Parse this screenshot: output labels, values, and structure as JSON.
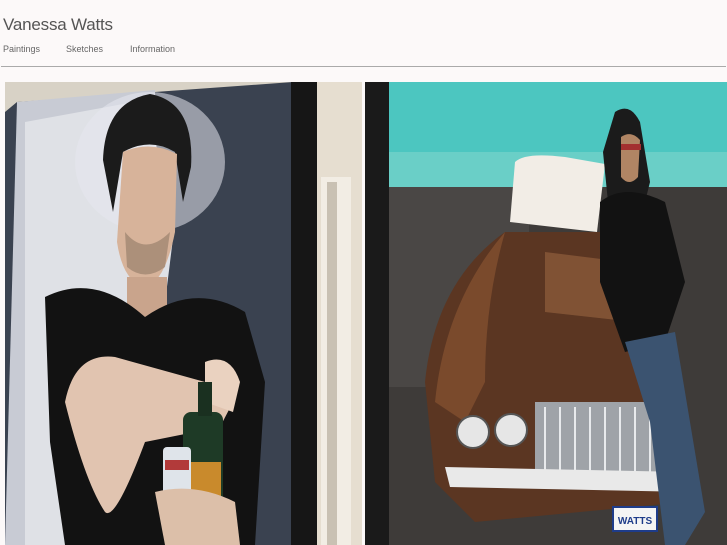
{
  "header": {
    "site_title": "Vanessa Watts"
  },
  "nav": {
    "items": [
      {
        "label": "Paintings"
      },
      {
        "label": "Sketches"
      },
      {
        "label": "Information"
      }
    ]
  },
  "gallery": {
    "images": [
      {
        "subject": "portrait-painting-man-with-bottle"
      },
      {
        "subject": "portrait-painting-man-with-car",
        "plate_text": "WATTS"
      }
    ]
  }
}
